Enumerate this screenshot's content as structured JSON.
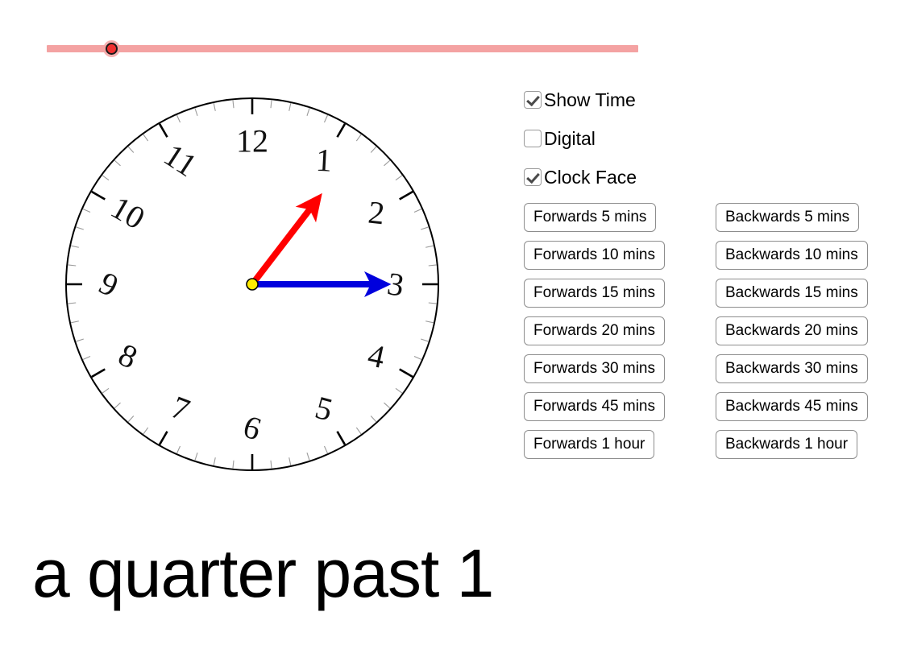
{
  "slider": {
    "name": "time-slider",
    "value_fraction": 0.1,
    "track_color": "#f4a2a2",
    "thumb_color": "#f03030",
    "thumb_border_color": "#1a1a1a"
  },
  "clock": {
    "hour_numerals": [
      "12",
      "1",
      "2",
      "3",
      "4",
      "5",
      "6",
      "7",
      "8",
      "9",
      "10",
      "11"
    ],
    "hour_hand": {
      "label": "hour-hand",
      "color": "#ff0000",
      "points_to_hour": 1,
      "angle_degrees": 37.5
    },
    "minute_hand": {
      "label": "minute-hand",
      "color": "#0000dd",
      "points_to_minute": 15,
      "angle_degrees": 90
    },
    "center_dot_color": "#ffeb00",
    "face_border_color": "#000000",
    "hour_tick_color": "#000000",
    "minute_tick_color": "#9a9a9a",
    "displayed_time": "1:15"
  },
  "controls": {
    "checkboxes": [
      {
        "label": "Show Time",
        "checked": true
      },
      {
        "label": "Digital",
        "checked": false
      },
      {
        "label": "Clock Face",
        "checked": true
      }
    ],
    "buttons_forwards": [
      "Forwards 5 mins",
      "Forwards 10 mins",
      "Forwards 15 mins",
      "Forwards 20 mins",
      "Forwards 30 mins",
      "Forwards 45 mins",
      "Forwards 1 hour"
    ],
    "buttons_backwards": [
      "Backwards 5 mins",
      "Backwards 10 mins",
      "Backwards 15 mins",
      "Backwards 20 mins",
      "Backwards 30 mins",
      "Backwards 45 mins",
      "Backwards 1 hour"
    ]
  },
  "readout": {
    "text": "a quarter past 1"
  }
}
